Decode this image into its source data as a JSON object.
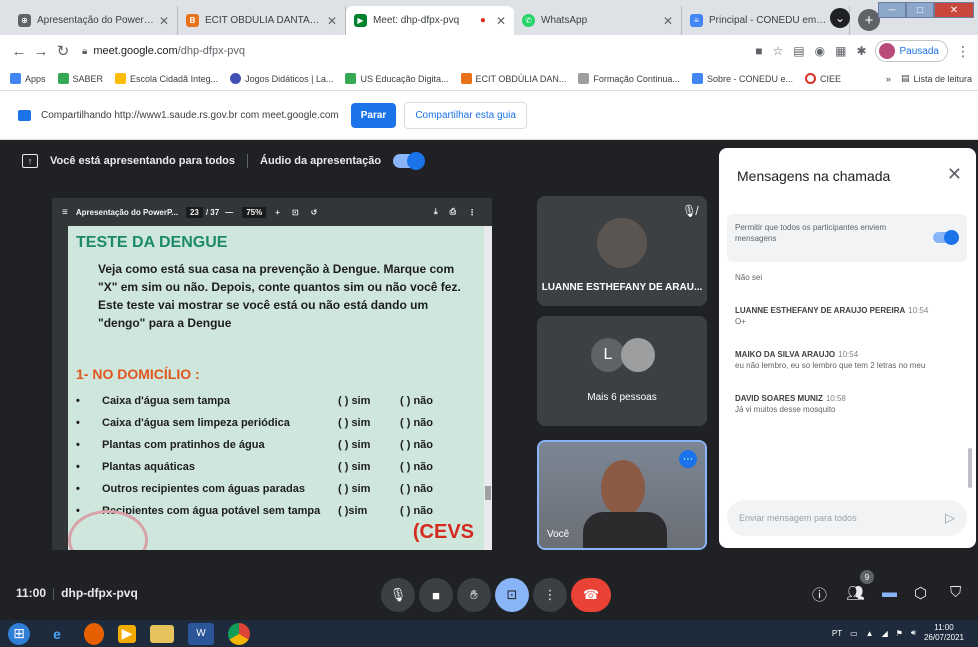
{
  "browser": {
    "tabs": [
      {
        "title": "Apresentação do PowerPoint",
        "color": "#5f6368"
      },
      {
        "title": "ECIT OBDÚLIA DANTAS: Aulas",
        "color": "#e8711a"
      },
      {
        "title": "Meet: dhp-dfpx-pvq",
        "color": "#00832d",
        "active": true,
        "recording": "●"
      },
      {
        "title": "WhatsApp",
        "color": "#25d366"
      },
      {
        "title": "Principal - CONEDU em Maceió",
        "color": "#4285f4"
      }
    ],
    "newtab_label": "+",
    "url_host": "meet.google.com",
    "url_path": "/dhp-dfpx-pvq",
    "profile_label": "Pausada",
    "bookmarks": [
      {
        "label": "Apps",
        "color": "#4285f4"
      },
      {
        "label": "SABER",
        "color": "#34a853"
      },
      {
        "label": "Escola Cidadã Integ...",
        "color": "#fbbc04"
      },
      {
        "label": "Jogos Didáticos | La...",
        "color": "#3f51b5"
      },
      {
        "label": "US Educação Digita...",
        "color": "#34a853"
      },
      {
        "label": "ECIT OBDÚLIA DAN...",
        "color": "#e8711a"
      },
      {
        "label": "Formação Continua...",
        "color": "#9e9e9e"
      },
      {
        "label": "Sobre - CONEDU e...",
        "color": "#4285f4"
      },
      {
        "label": "CIEE",
        "color": "#d93025"
      }
    ],
    "bookmarks_more": "»",
    "reading_list": "Lista de leitura"
  },
  "sharebar": {
    "text": "Compartilhando http://www1.saude.rs.gov.br com meet.google.com",
    "stop_label": "Parar",
    "share_tab_label": "Compartilhar esta guia"
  },
  "meet": {
    "presenting_text": "Você está apresentando para todos",
    "audio_label": "Áudio da apresentação",
    "pdf": {
      "title": "Apresentação do PowerP...",
      "page": "23",
      "total": "/ 37",
      "zoom": "75%"
    },
    "slide": {
      "title": "TESTE DA DENGUE",
      "intro": "Veja como está sua casa na prevenção à Dengue. Marque com \"X\" em sim ou não. Depois, conte quantos sim ou não você fez. Este teste vai mostrar se você está ou não está dando um \"dengo\" para a Dengue",
      "section": "1- NO DOMICÍLIO :",
      "items": [
        {
          "text": "Caixa d'água sem tampa",
          "yes": "( ) sim",
          "no": "( ) não"
        },
        {
          "text": "Caixa d'água sem limpeza periódica",
          "yes": "( ) sim",
          "no": "( ) não"
        },
        {
          "text": "Plantas com pratinhos de água",
          "yes": "( ) sim",
          "no": "( ) não"
        },
        {
          "text": "Plantas aquáticas",
          "yes": "( ) sim",
          "no": "( ) não"
        },
        {
          "text": "Outros recipientes com águas paradas",
          "yes": "( ) sim",
          "no": "( ) não"
        },
        {
          "text": "Recipientes com água potável sem tampa",
          "yes": "( )sim",
          "no": "( ) não"
        }
      ],
      "bullet": "•",
      "logo": "(CEVS"
    },
    "tiles": {
      "participant1": "LUANNE ESTHEFANY DE ARAU...",
      "more_people": "Mais 6 pessoas",
      "more_initial": "L",
      "self": "Você"
    },
    "chat": {
      "title": "Mensagens na chamada",
      "allow_text": "Permitir que todos os participantes enviem mensagens",
      "messages": [
        {
          "who": "",
          "time": "",
          "text": "Não sei"
        },
        {
          "who": "LUANNE ESTHEFANY DE ARAUJO PEREIRA",
          "time": "10:54",
          "text": "O+"
        },
        {
          "who": "MAIKO DA SILVA ARAUJO",
          "time": "10:54",
          "text": "eu não lembro, eu so lembro que tem 2 letras no meu"
        },
        {
          "who": "DAVID SOARES MUNIZ",
          "time": "10:58",
          "text": "Já vi muitos desse mosquito"
        }
      ],
      "input_placeholder": "Enviar mensagem para todos"
    },
    "controls": {
      "time": "11:00",
      "code": "dhp-dfpx-pvq",
      "people_count": "9"
    }
  },
  "taskbar": {
    "lang": "PT",
    "time": "11:00",
    "date": "26/07/2021"
  }
}
